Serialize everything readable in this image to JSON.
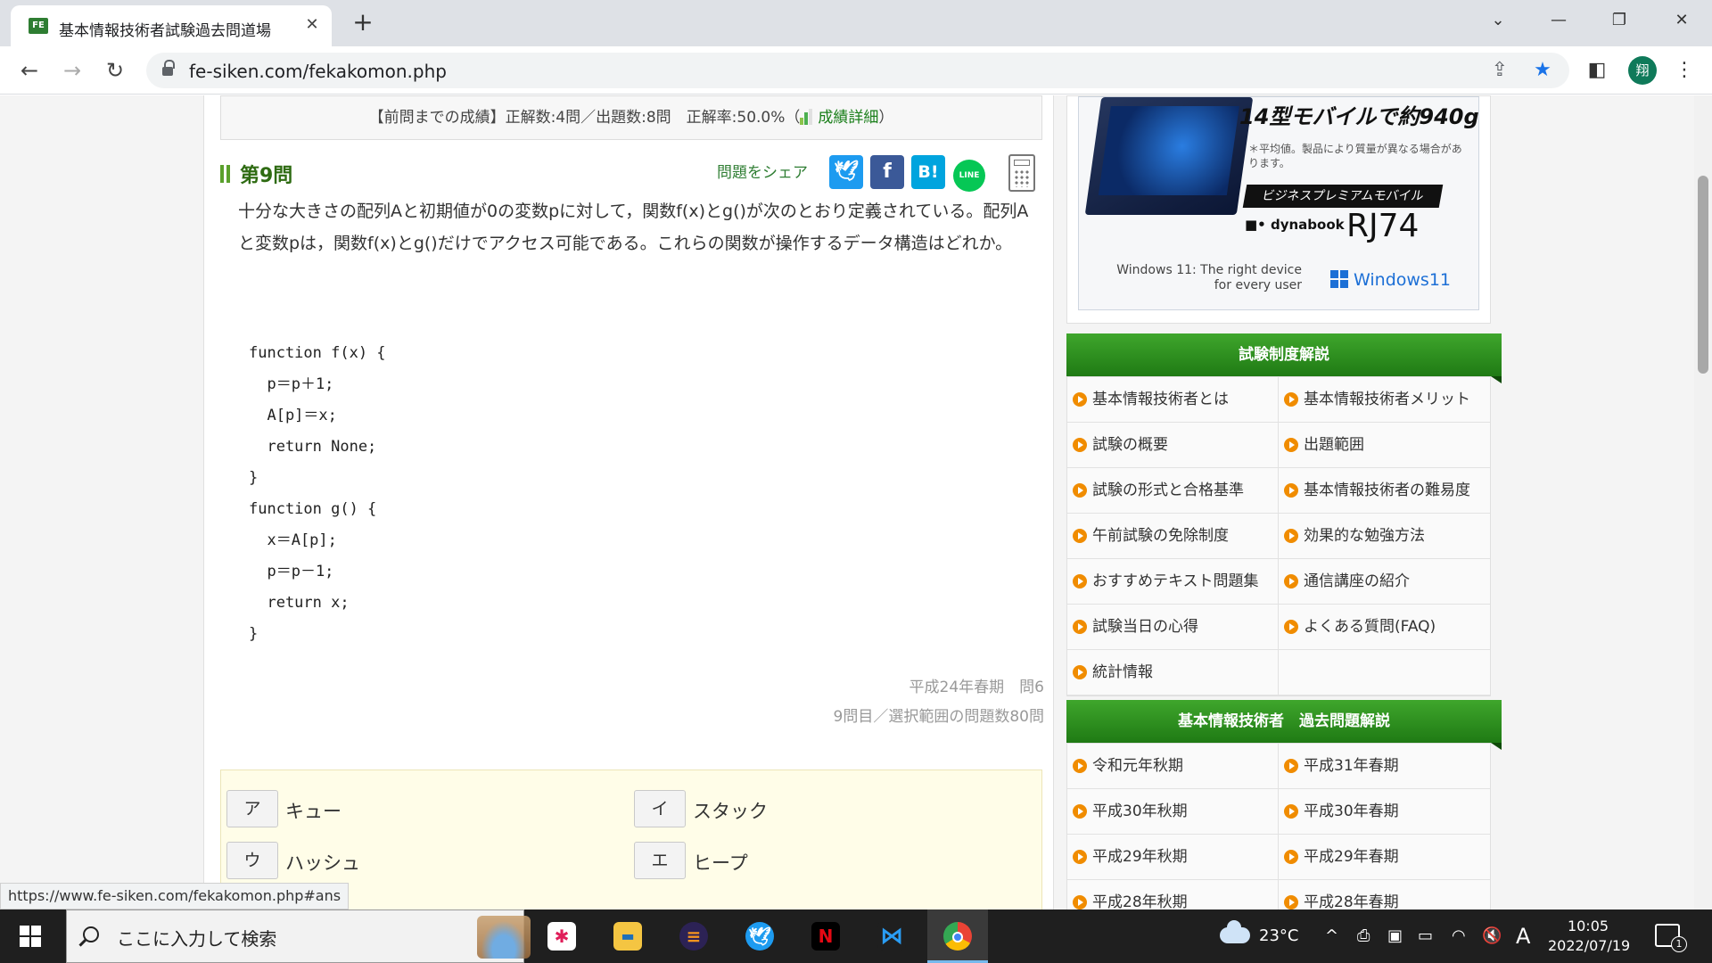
{
  "browser": {
    "tab_title": "基本情報技術者試験過去問道場",
    "favicon_text": "FE",
    "new_tab": "+",
    "url": "fe-siken.com/fekakomon.php",
    "status_url": "https://www.fe-siken.com/fekakomon.php#ans",
    "profile_initial": "翔"
  },
  "record": {
    "text": "【前問までの成績】正解数:4問／出題数:8問　正解率:50.0%（",
    "detail_link": "成績詳細",
    "close": "）"
  },
  "question": {
    "number_label": "第9問",
    "share_label": "問題をシェア",
    "share_buttons": [
      "twitter",
      "facebook",
      "hatena",
      "line"
    ],
    "share_hatena_text": "B!",
    "share_line_text": "LINE",
    "text": "十分な大きさの配列Aと初期値が0の変数pに対して，関数f(x)とg()が次のとおり定義されている。配列Aと変数pは，関数f(x)とg()だけでアクセス可能である。これらの関数が操作するデータ構造はどれか。",
    "code_lines": [
      "function f(x) {",
      "  p＝p＋1;",
      "  A[p]＝x;",
      "  return None;",
      "}",
      "function g() {",
      "  x＝A[p];",
      "  p＝p－1;",
      "  return x;",
      "}"
    ],
    "source": "平成24年春期　問6",
    "range_info": "9問目／選択範囲の問題数80問"
  },
  "choices": [
    {
      "key": "ア",
      "text": "キュー"
    },
    {
      "key": "イ",
      "text": "スタック"
    },
    {
      "key": "ウ",
      "text": "ハッシュ"
    },
    {
      "key": "エ",
      "text": "ヒープ"
    }
  ],
  "ad": {
    "headline": "14型モバイルで約940g",
    "note": "＊平均値。製品により質量が異なる場合があります。",
    "banner": "ビジネスプレミアムモバイル",
    "brand": "dynabook",
    "model": "RJ74",
    "tagline": "Windows 11: The right device for every user",
    "windows": "Windows11"
  },
  "sidebar": {
    "section1_title": "試験制度解説",
    "section1_items": [
      [
        "基本情報技術者とは",
        "基本情報技術者メリット"
      ],
      [
        "試験の概要",
        "出題範囲"
      ],
      [
        "試験の形式と合格基準",
        "基本情報技術者の難易度"
      ],
      [
        "午前試験の免除制度",
        "効果的な勉強方法"
      ],
      [
        "おすすめテキスト問題集",
        "通信講座の紹介"
      ],
      [
        "試験当日の心得",
        "よくある質問(FAQ)"
      ],
      [
        "統計情報",
        ""
      ]
    ],
    "section2_title": "基本情報技術者　過去問題解説",
    "section2_items": [
      [
        "令和元年秋期",
        "平成31年春期"
      ],
      [
        "平成30年秋期",
        "平成30年春期"
      ],
      [
        "平成29年秋期",
        "平成29年春期"
      ],
      [
        "平成28年秋期",
        "平成28年春期"
      ]
    ]
  },
  "taskbar": {
    "search_placeholder": "ここに入力して検索",
    "weather": "23°C",
    "ime": "A",
    "time": "10:05",
    "date": "2022/07/19",
    "notification_count": "1"
  }
}
